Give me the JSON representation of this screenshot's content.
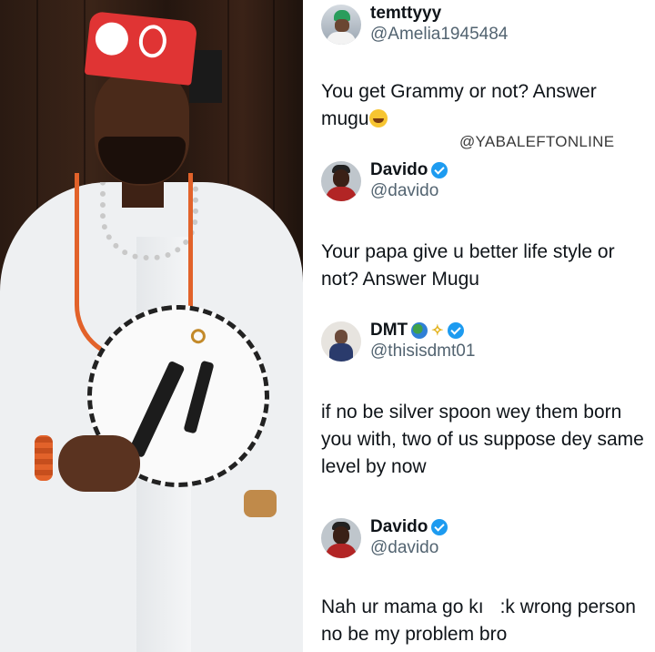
{
  "tweets": [
    {
      "display_name": "temttyyy",
      "handle": "@Amelia1945484",
      "text": "You get Grammy or not? Answer mugu",
      "emoji": "face-with-tears-of-joy"
    },
    {
      "display_name": "Davido",
      "handle": "@davido",
      "verified": true,
      "text": "Your papa give u better life style or not? Answer Mugu"
    },
    {
      "display_name": "DMT",
      "handle": "@thisisdmt01",
      "verified": true,
      "name_emojis": [
        "globe-icon",
        "dizzy-icon"
      ],
      "text": "if no be silver spoon wey them born you with, two of us suppose dey same level by now"
    },
    {
      "display_name": "Davido",
      "handle": "@davido",
      "verified": true,
      "text_part1": "Nah ur mama go kı",
      "text_part2": ":k wrong person no be my problem bro"
    }
  ],
  "watermark": "@YABALEFTONLINE",
  "colors": {
    "verified_blue": "#1d9bf0",
    "handle_grey": "#536471",
    "text_dark": "#0f1419"
  }
}
